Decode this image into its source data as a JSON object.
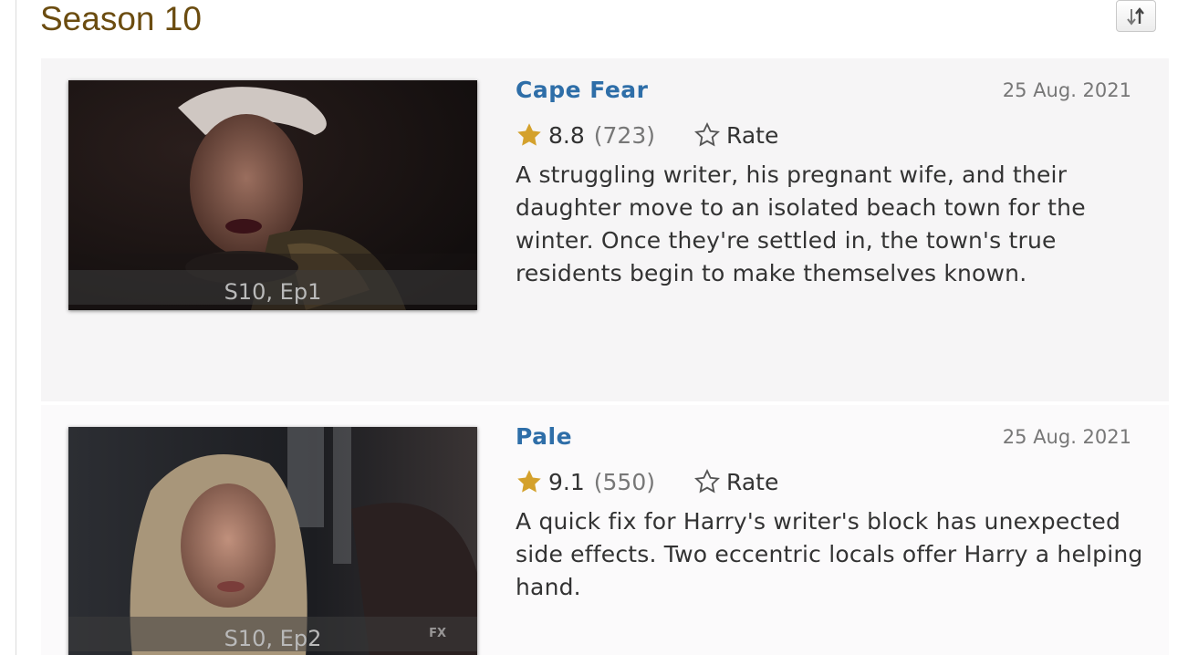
{
  "season": {
    "title": "Season 10",
    "sort_icon": "sort-arrows-icon"
  },
  "episodes": [
    {
      "title": "Cape Fear",
      "date": "25 Aug. 2021",
      "rating": "8.8",
      "votes": "(723)",
      "rate_label": "Rate",
      "description": "A struggling writer, his pregnant wife, and their daughter move to an isolated beach town for the winter. Once they're settled in, the town's true residents begin to make themselves known.",
      "thumb_caption": "S10, Ep1"
    },
    {
      "title": "Pale",
      "date": "25 Aug. 2021",
      "rating": "9.1",
      "votes": "(550)",
      "rate_label": "Rate",
      "description": "A quick fix for Harry's writer's block has unexpected side effects. Two eccentric locals offer Harry a helping hand.",
      "thumb_caption": "S10, Ep2",
      "thumb_watermark": "FX"
    }
  ],
  "colors": {
    "title_link": "#2e6ea8",
    "season_heading": "#6b4c10",
    "rating_star": "#e0a526"
  }
}
